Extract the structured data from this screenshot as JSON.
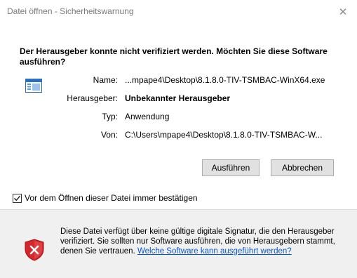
{
  "window": {
    "title": "Datei öffnen - Sicherheitswarnung",
    "close_glyph": "✕"
  },
  "headline": "Der Herausgeber konnte nicht verifiziert werden. Möchten Sie diese Software ausführen?",
  "details": {
    "name_label": "Name:",
    "name_value": "...mpape4\\Desktop\\8.1.8.0-TIV-TSMBAC-WinX64.exe",
    "publisher_label": "Herausgeber:",
    "publisher_value": "Unbekannter Herausgeber",
    "type_label": "Typ:",
    "type_value": "Anwendung",
    "from_label": "Von:",
    "from_value": "C:\\Users\\mpape4\\Desktop\\8.1.8.0-TIV-TSMBAC-W..."
  },
  "buttons": {
    "run": "Ausführen",
    "cancel": "Abbrechen"
  },
  "checkbox": {
    "label": "Vor dem Öffnen dieser Datei immer bestätigen",
    "checked": true
  },
  "warning": {
    "text": "Diese Datei verfügt über keine gültige digitale Signatur, die den Herausgeber verifiziert. Sie sollten nur Software ausführen, die von Herausgebern stammt, denen Sie vertrauen. ",
    "link": "Welche Software kann ausgeführt werden?"
  },
  "icons": {
    "file": "application-file-icon",
    "shield": "security-shield-error-icon"
  },
  "colors": {
    "link": "#0a56c8",
    "shield_red": "#d4262b",
    "lower_panel": "#f0f0f0",
    "button_bg": "#e1e1e1"
  }
}
